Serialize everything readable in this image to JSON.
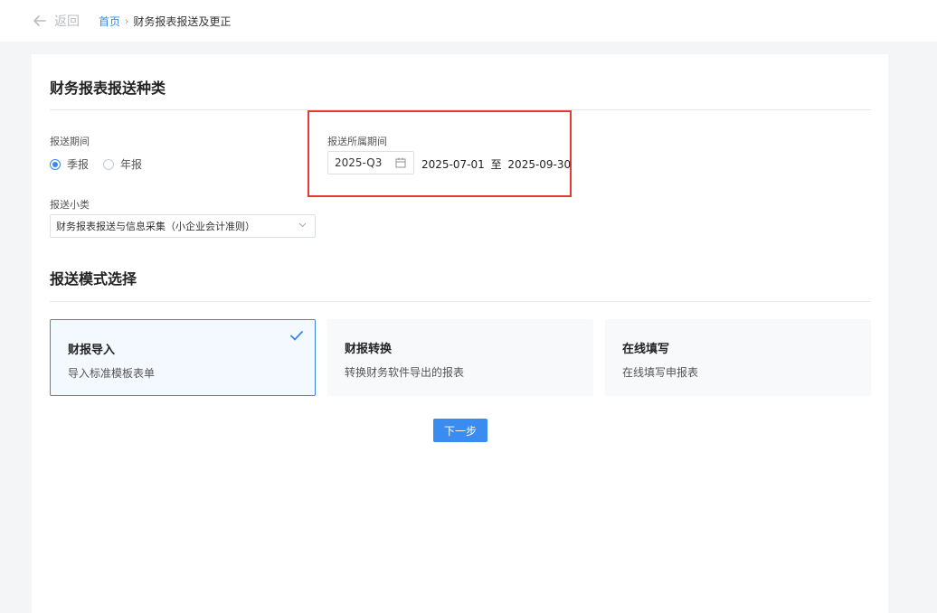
{
  "header": {
    "back_label": "返回",
    "breadcrumb": {
      "home": "首页",
      "separator": "›",
      "current": "财务报表报送及更正"
    }
  },
  "section_type": {
    "title": "财务报表报送种类",
    "period_label": "报送期间",
    "period_options": [
      {
        "label": "季报",
        "selected": true
      },
      {
        "label": "年报",
        "selected": false
      }
    ],
    "belong_label": "报送所属期间",
    "quarter_value": "2025-Q3",
    "range_start": "2025-07-01",
    "range_sep": "至",
    "range_end": "2025-09-30",
    "subtype_label": "报送小类",
    "subtype_value": "财务报表报送与信息采集（小企业会计准则）"
  },
  "section_mode": {
    "title": "报送模式选择",
    "modes": [
      {
        "title": "财报导入",
        "desc": "导入标准模板表单",
        "selected": true
      },
      {
        "title": "财报转换",
        "desc": "转换财务软件导出的报表",
        "selected": false
      },
      {
        "title": "在线填写",
        "desc": "在线填写申报表",
        "selected": false
      }
    ]
  },
  "next_button": "下一步",
  "colors": {
    "accent": "#3b86ea",
    "highlight_box": "#e53935",
    "button": "#3b8cf0"
  }
}
